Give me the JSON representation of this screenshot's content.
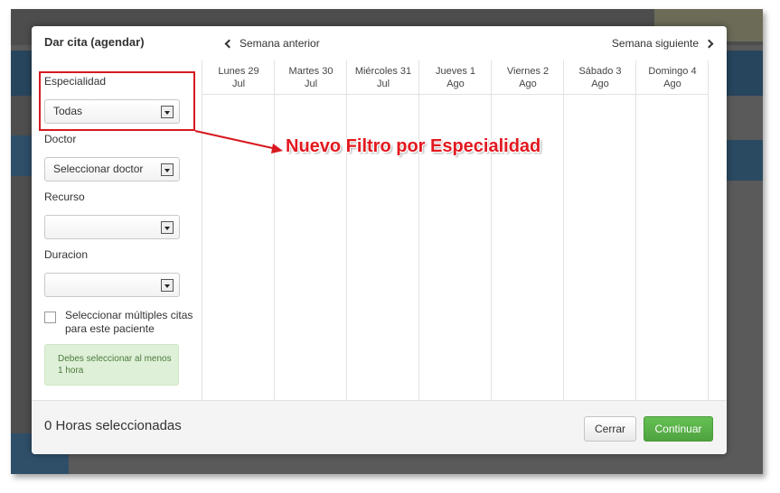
{
  "modal": {
    "title": "Dar cita (agendar)",
    "prev_week": "Semana anterior",
    "next_week": "Semana siguiente"
  },
  "filters": {
    "specialty_label": "Especialidad",
    "specialty_value": "Todas",
    "doctor_label": "Doctor",
    "doctor_value": "Seleccionar doctor",
    "resource_label": "Recurso",
    "resource_value": "",
    "duration_label": "Duracion",
    "duration_value": "",
    "multi_label": "Seleccionar múltiples citas para este paciente",
    "multi_checked": false,
    "hint": "Debes seleccionar al menos 1 hora"
  },
  "calendar": {
    "days": [
      {
        "name": "Lunes 29",
        "month": "Jul"
      },
      {
        "name": "Martes 30",
        "month": "Jul"
      },
      {
        "name": "Miércoles 31",
        "month": "Jul"
      },
      {
        "name": "Jueves 1",
        "month": "Ago"
      },
      {
        "name": "Viernes 2",
        "month": "Ago"
      },
      {
        "name": "Sábado 3",
        "month": "Ago"
      },
      {
        "name": "Domingo 4",
        "month": "Ago"
      }
    ]
  },
  "footer": {
    "hours_selected": "0 Horas seleccionadas",
    "close_label": "Cerrar",
    "continue_label": "Continuar"
  },
  "annotation": {
    "text": "Nuevo Filtro por Especialidad",
    "color": "#e3181f"
  },
  "colors": {
    "accent_green": "#5cb34a",
    "hint_bg": "#dff0d8",
    "background_blue": "#27455d"
  }
}
